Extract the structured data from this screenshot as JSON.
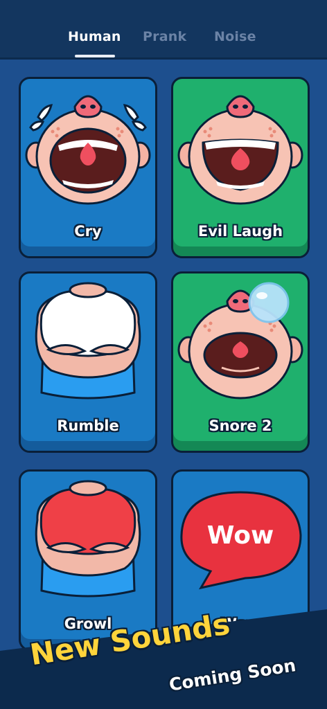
{
  "tabs": [
    {
      "label": "Human",
      "active": true
    },
    {
      "label": "Prank",
      "active": false
    },
    {
      "label": "Noise",
      "active": false
    }
  ],
  "cards": [
    {
      "label": "Cry",
      "color": "blue",
      "art": "crying-face-icon"
    },
    {
      "label": "Evil Laugh",
      "color": "green",
      "art": "laughing-face-icon"
    },
    {
      "label": "Rumble",
      "color": "blue",
      "art": "white-shirt-belly-icon"
    },
    {
      "label": "Snore 2",
      "color": "green",
      "art": "snoring-face-icon"
    },
    {
      "label": "Growl",
      "color": "blue",
      "art": "red-shirt-belly-icon"
    },
    {
      "label": "Wow",
      "color": "blue",
      "art": "speech-bubble-icon",
      "bubble_text": "Wow"
    }
  ],
  "banner": {
    "title": "New Sounds",
    "subtitle": "Coming Soon"
  },
  "colors": {
    "background": "#1d4f8e",
    "header": "#13365f",
    "card_blue": "#1a7ac4",
    "card_green": "#1fb06d",
    "banner_title": "#ffd43b",
    "bubble_red": "#e8323f"
  }
}
